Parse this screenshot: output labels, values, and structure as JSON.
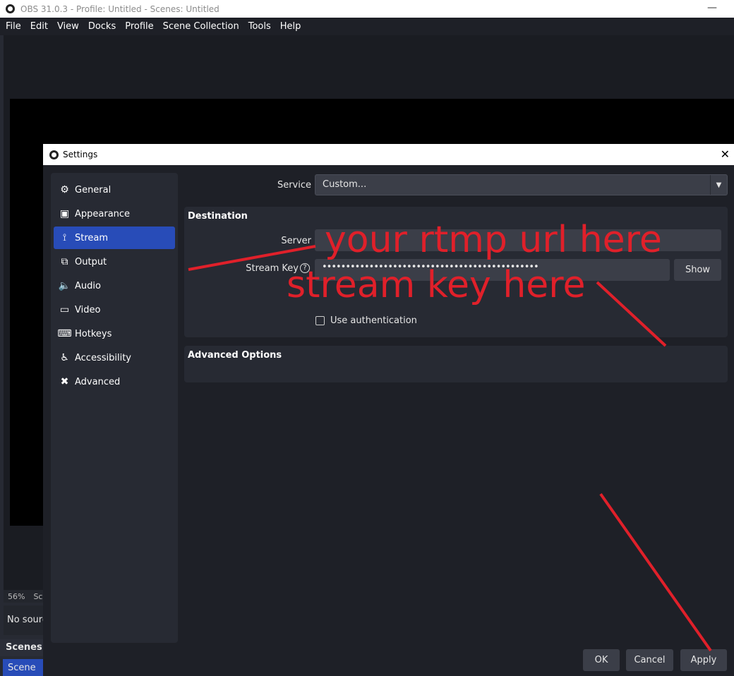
{
  "window": {
    "title": "OBS 31.0.3 - Profile: Untitled - Scenes: Untitled",
    "minimize_glyph": "—"
  },
  "menu": [
    "File",
    "Edit",
    "View",
    "Docks",
    "Profile",
    "Scene Collection",
    "Tools",
    "Help"
  ],
  "main": {
    "zoom": "56%",
    "zoom_extra": "Sca",
    "no_source": "No source",
    "scenes_header": "Scenes",
    "scene_item": "Scene"
  },
  "settings": {
    "title": "Settings",
    "close_glyph": "✕",
    "sidebar": [
      {
        "label": "General",
        "icon": "gear-icon",
        "glyph": "⚙"
      },
      {
        "label": "Appearance",
        "icon": "appearance-icon",
        "glyph": "▣"
      },
      {
        "label": "Stream",
        "icon": "antenna-icon",
        "glyph": "⟟"
      },
      {
        "label": "Output",
        "icon": "output-icon",
        "glyph": "⧉"
      },
      {
        "label": "Audio",
        "icon": "speaker-icon",
        "glyph": "🔈"
      },
      {
        "label": "Video",
        "icon": "monitor-icon",
        "glyph": "▭"
      },
      {
        "label": "Hotkeys",
        "icon": "keyboard-icon",
        "glyph": "⌨"
      },
      {
        "label": "Accessibility",
        "icon": "accessibility-icon",
        "glyph": "♿"
      },
      {
        "label": "Advanced",
        "icon": "tools-icon",
        "glyph": "✖"
      }
    ],
    "active_item": "Stream",
    "service_label": "Service",
    "service_value": "Custom...",
    "dropdown_glyph": "▼",
    "destination_title": "Destination",
    "server_label": "Server",
    "server_value": "",
    "stream_key_label": "Stream Key",
    "help_glyph": "?",
    "stream_key_masked": "••••••••••••••••••••••••••••••••••••••••••••••",
    "show_label": "Show",
    "auth_label": "Use authentication",
    "advanced_title": "Advanced Options",
    "ok_label": "OK",
    "cancel_label": "Cancel",
    "apply_label": "Apply"
  },
  "annotations": {
    "url_text": "your rtmp url here",
    "key_text": "stream key here",
    "color": "#e0202a"
  }
}
